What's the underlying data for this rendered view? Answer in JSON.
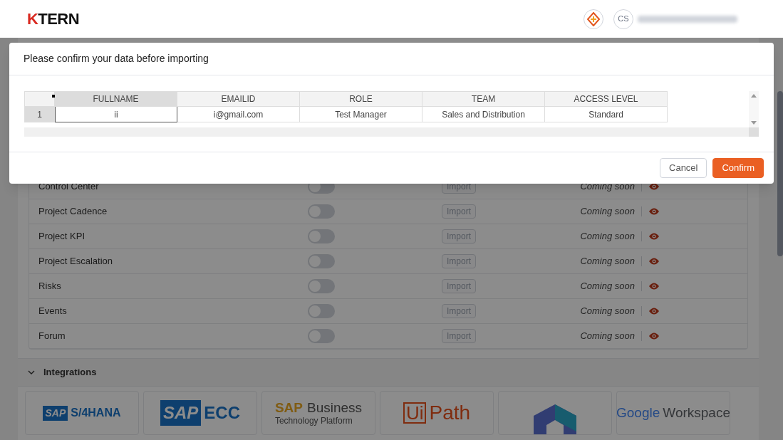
{
  "header": {
    "logo": {
      "accent": "K",
      "rest": "TERN"
    },
    "avatar": "CS"
  },
  "modules": [
    {
      "name": "Control Center",
      "on": false,
      "action": "Import",
      "status": "Coming soon"
    },
    {
      "name": "Project Cadence",
      "on": false,
      "action": "Import",
      "status": "Coming soon"
    },
    {
      "name": "Project KPI",
      "on": false,
      "action": "Import",
      "status": "Coming soon"
    },
    {
      "name": "Project Escalation",
      "on": false,
      "action": "Import",
      "status": "Coming soon"
    },
    {
      "name": "Risks",
      "on": false,
      "action": "Import",
      "status": "Coming soon"
    },
    {
      "name": "Events",
      "on": false,
      "action": "Import",
      "status": "Coming soon"
    },
    {
      "name": "Forum",
      "on": false,
      "action": "Import",
      "status": "Coming soon"
    }
  ],
  "integrations": {
    "title": "Integrations",
    "expanded": true,
    "logos": [
      {
        "kind": "s4hana",
        "parts": [
          "SAP",
          "S/4HANA"
        ]
      },
      {
        "kind": "ecc",
        "parts": [
          "SAP",
          "ECC"
        ]
      },
      {
        "kind": "btp",
        "parts": [
          "SAP",
          "Business",
          "Technology Platform"
        ]
      },
      {
        "kind": "uipath",
        "parts": [
          "Ui",
          "Path"
        ]
      },
      {
        "kind": "hexagon"
      },
      {
        "kind": "google",
        "parts": [
          "Google",
          "Workspace"
        ]
      }
    ]
  },
  "dialog": {
    "title": "Please confirm your data before importing",
    "table": {
      "columns": [
        "FULLNAME",
        "EMAILID",
        "ROLE",
        "TEAM",
        "ACCESS LEVEL"
      ],
      "rows": [
        {
          "number": "1",
          "cells": [
            "ii",
            "i@gmail.com",
            "Test Manager",
            "Sales and Distribution",
            "Standard"
          ]
        }
      ]
    },
    "buttons": [
      {
        "label": "Cancel",
        "kind": "secondary"
      },
      {
        "label": "Confirm",
        "kind": "primary"
      }
    ]
  }
}
